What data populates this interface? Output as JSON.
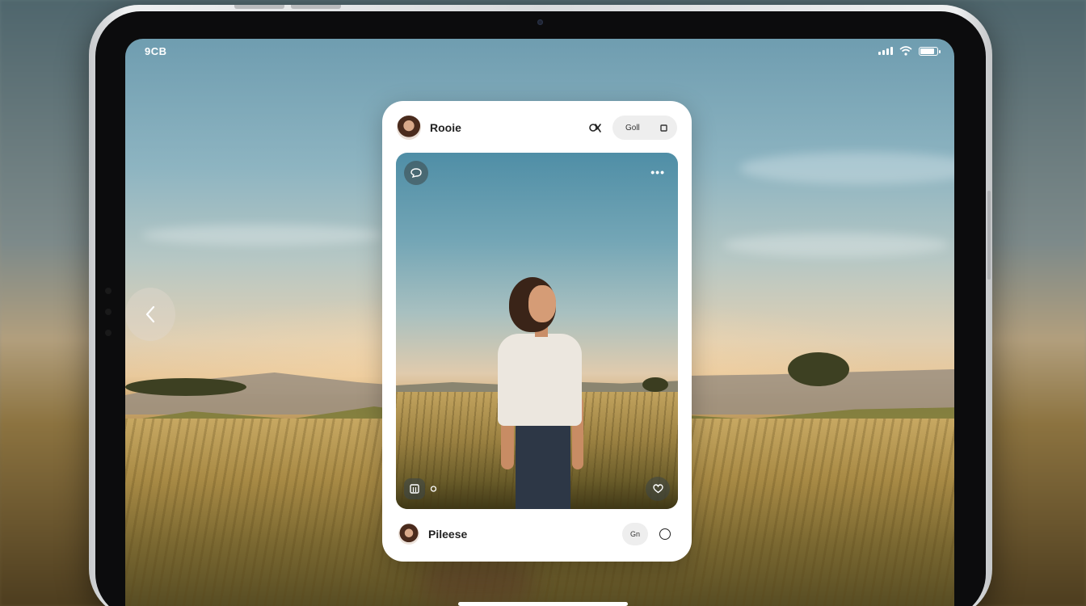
{
  "status_bar": {
    "time": "9CB",
    "icons": [
      "signal-icon",
      "wifi-icon",
      "battery-icon"
    ]
  },
  "navigation": {
    "back_icon": "chevron-left-icon"
  },
  "card": {
    "header": {
      "name": "Rooie",
      "icon": "tag-icon",
      "pill_label": "Goll",
      "pill_icon": "square-icon"
    },
    "photo": {
      "top_left_icon": "chat-bubble-icon",
      "more_label": "•••",
      "tool_icons": [
        "grid-icon",
        "small-chat-icon"
      ],
      "bottom_right_icon": "heart-icon"
    },
    "footer": {
      "name": "Pileese",
      "pill_label": "Gn",
      "circle_icon": "circle-icon"
    }
  },
  "colors": {
    "card_background": "#ffffff",
    "pill_background": "#eeeeee",
    "text_primary": "#222222"
  }
}
